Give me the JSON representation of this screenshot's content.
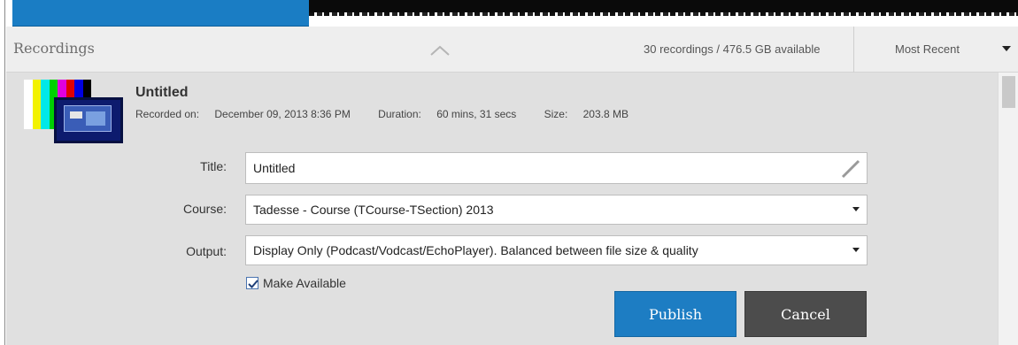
{
  "header": {
    "title": "Recordings",
    "storage_text": "30 recordings / 476.5 GB available",
    "sort": {
      "selected": "Most Recent"
    }
  },
  "recording": {
    "title": "Untitled",
    "recorded_on_label": "Recorded on:",
    "recorded_on": "December 09, 2013 8:36 PM",
    "duration_label": "Duration:",
    "duration": "60 mins, 31 secs",
    "size_label": "Size:",
    "size": "203.8 MB"
  },
  "form": {
    "title_label": "Title:",
    "title_value": "Untitled",
    "course_label": "Course:",
    "course_value": "Tadesse - Course (TCourse-TSection) 2013",
    "output_label": "Output:",
    "output_value": "Display Only (Podcast/Vodcast/EchoPlayer). Balanced between file size & quality",
    "make_available_label": "Make Available",
    "make_available_checked": true
  },
  "buttons": {
    "publish": "Publish",
    "cancel": "Cancel"
  },
  "colors": {
    "accent": "#1d7dc3",
    "cancel": "#4c4c4c",
    "panel": "#e0e0e0",
    "header": "#eeeeee"
  },
  "icons": {
    "collapse": "chevron-up-icon",
    "sort": "caret-down-icon",
    "edit": "pencil-icon",
    "select": "caret-down-icon",
    "checkbox": "checkmark-icon"
  }
}
